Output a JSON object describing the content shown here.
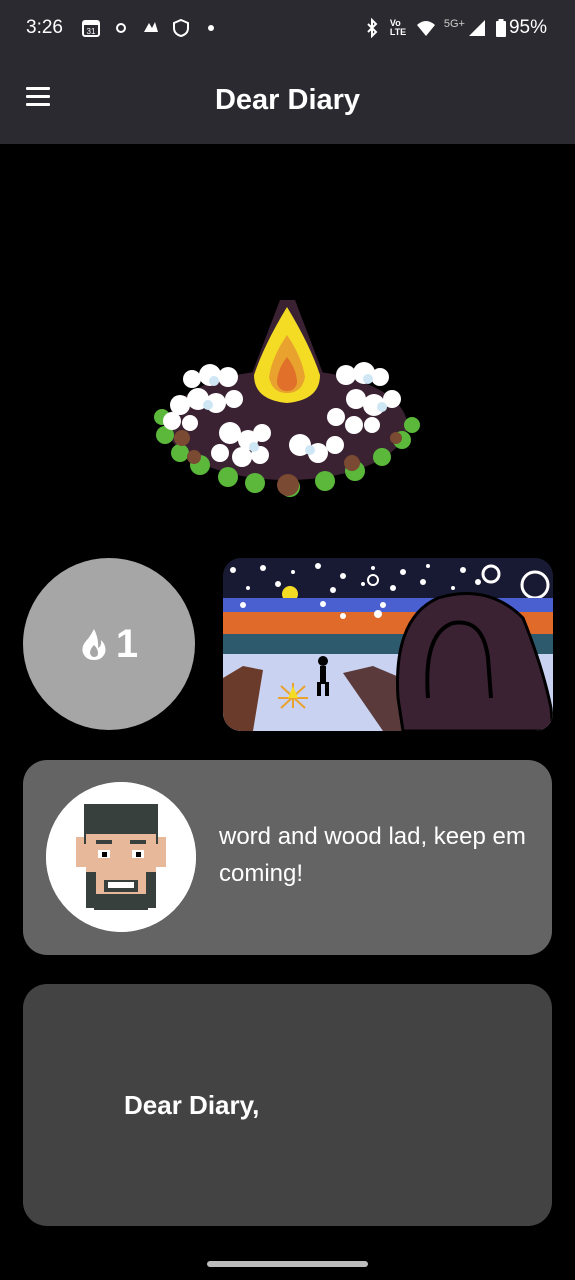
{
  "status_bar": {
    "time": "3:26",
    "network_label": "5G+",
    "volte_label": "Vo LTE",
    "battery": "95%",
    "icons": [
      "calendar-icon",
      "sync-icon",
      "app-icon",
      "shield-icon",
      "dot-icon",
      "bluetooth-icon",
      "volte-icon",
      "wifi-icon",
      "signal-icon",
      "battery-icon"
    ]
  },
  "app_bar": {
    "title": "Dear Diary",
    "menu_icon": "hamburger-menu-icon"
  },
  "streak": {
    "icon": "flame-icon",
    "count": "1"
  },
  "comment": {
    "text": "word and wood lad, keep em coming!"
  },
  "entry": {
    "text": "Dear Diary,"
  },
  "colors": {
    "bar": "#2b2a31",
    "background": "#000000",
    "streak_circle": "#a6a6a6",
    "comment_card": "#646464",
    "entry_card": "#434343"
  }
}
